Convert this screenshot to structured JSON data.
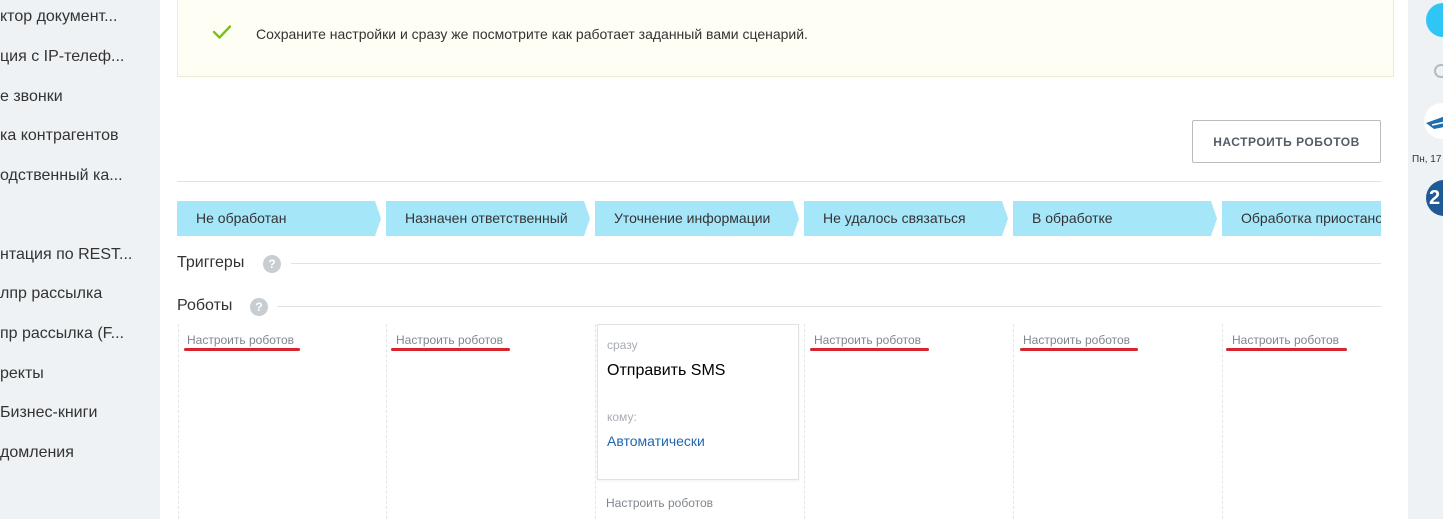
{
  "sidebar": {
    "items": [
      {
        "label": "ктор документ..."
      },
      {
        "label": "ция с IP-телеф..."
      },
      {
        "label": "е звонки"
      },
      {
        "label": "ка контрагентов"
      },
      {
        "label": "одственный ка..."
      },
      {
        "label": "нтация по REST..."
      },
      {
        "label": "лпр рассылка"
      },
      {
        "label": "пр рассылка (F..."
      },
      {
        "label": "ректы"
      },
      {
        "label": "Бизнес-книги"
      },
      {
        "label": "домления"
      }
    ]
  },
  "banner": {
    "text": "Сохраните настройки и сразу же посмотрите как работает заданный вами сценарий."
  },
  "toolbar": {
    "configure_robots": "НАСТРОИТЬ РОБОТОВ"
  },
  "stages": [
    {
      "label": "Не обработан"
    },
    {
      "label": "Назначен ответственный"
    },
    {
      "label": "Уточнение информации"
    },
    {
      "label": "Не удалось связаться"
    },
    {
      "label": "В обработке"
    },
    {
      "label": "Обработка приостановлена"
    }
  ],
  "stage_color": "#a6e6f9",
  "sections": {
    "triggers": "Триггеры",
    "robots": "Роботы",
    "help": "?"
  },
  "columns": {
    "configure_link": "Настроить роботов"
  },
  "robot_card": {
    "when": "сразу",
    "name": "Отправить SMS",
    "to_label": "кому:",
    "to_value": "Автоматически"
  },
  "highlight_color": "#d9232d",
  "right_panel": {
    "date": "Пн, 17",
    "badge": "2"
  }
}
